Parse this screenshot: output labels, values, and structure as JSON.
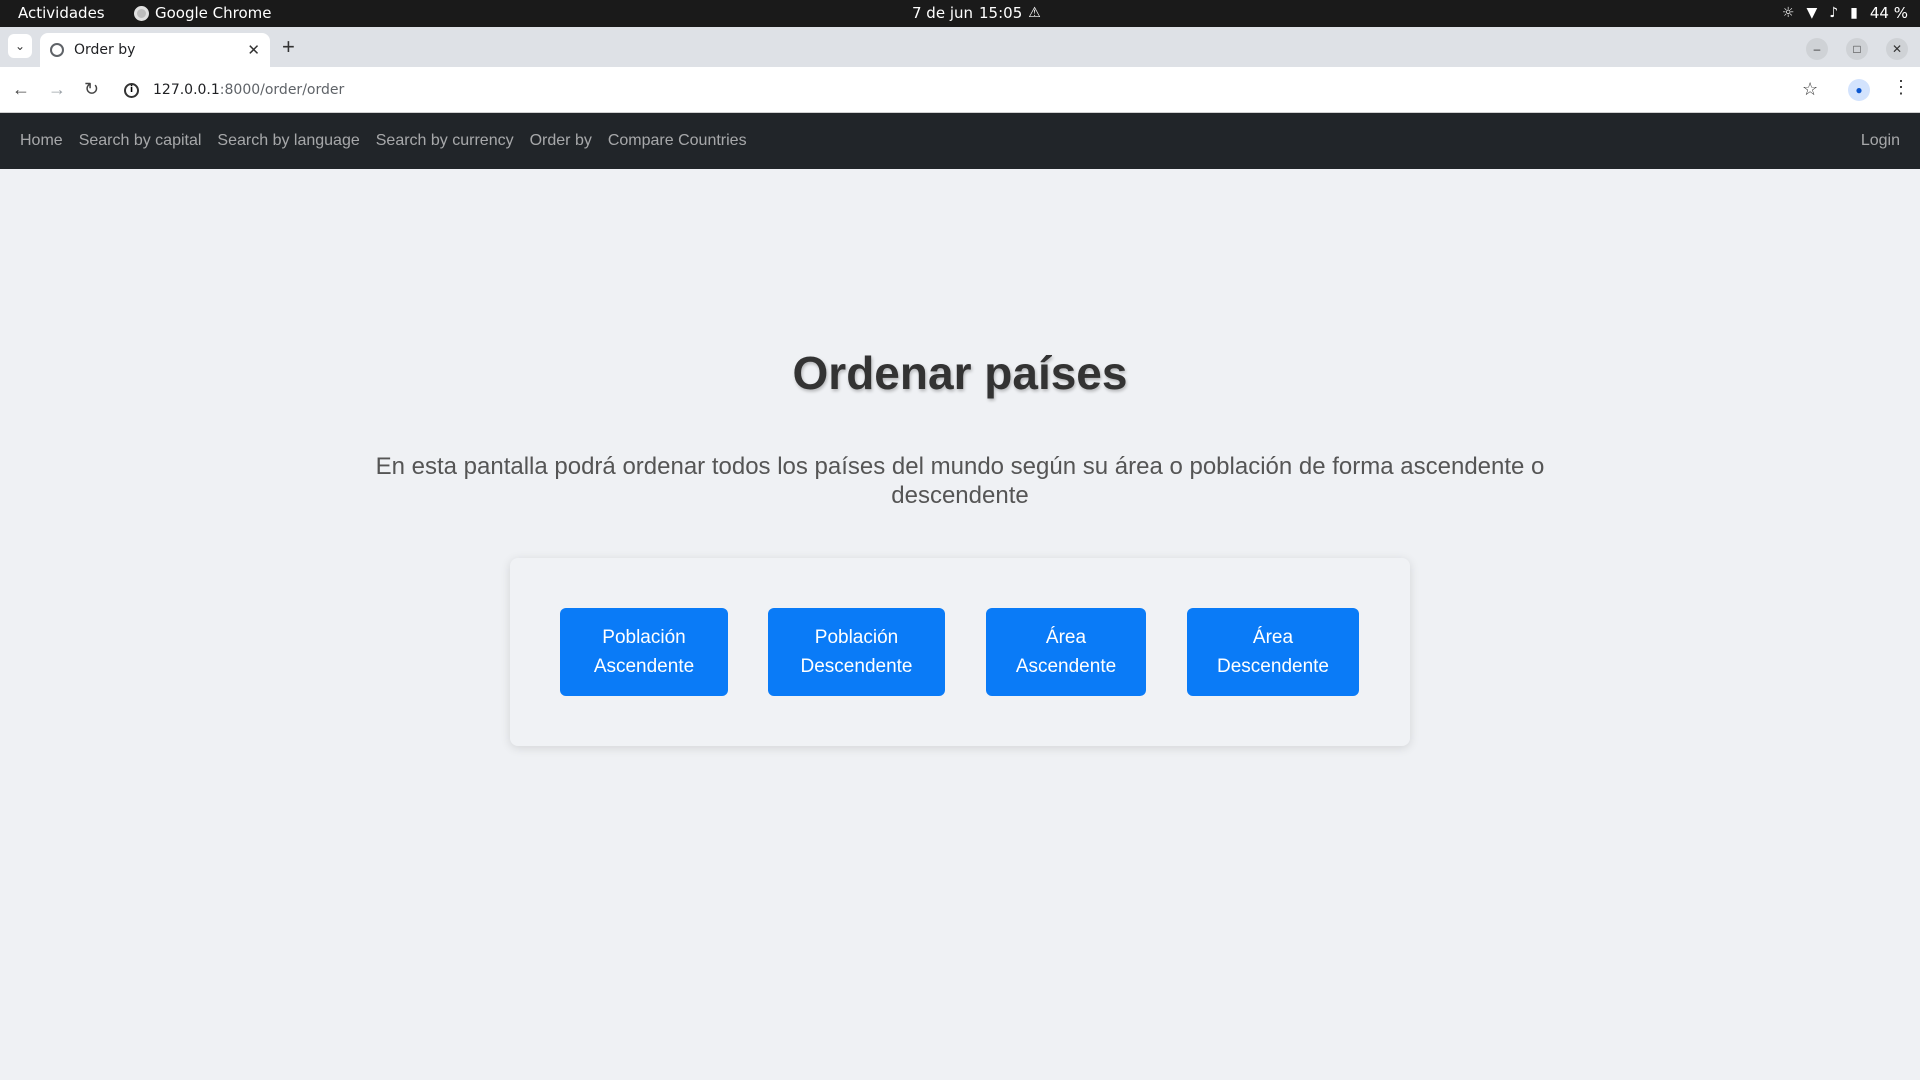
{
  "os": {
    "activities": "Actividades",
    "app_name": "Google Chrome",
    "date": "7 de jun",
    "time": "15:05",
    "battery": "44 %"
  },
  "browser": {
    "tab_title": "Order by",
    "url_host": "127.0.0.1",
    "url_path": ":8000/order/order"
  },
  "navbar": {
    "links": [
      "Home",
      "Search by capital",
      "Search by language",
      "Search by currency",
      "Order by",
      "Compare Countries"
    ],
    "login": "Login"
  },
  "main": {
    "title": "Ordenar países",
    "description": "En esta pantalla podrá ordenar todos los países del mundo según su área o población de forma ascendente o descendente",
    "buttons": [
      {
        "line1": "Población",
        "line2": "Ascendente"
      },
      {
        "line1": "Población",
        "line2": "Descendente"
      },
      {
        "line1": "Área",
        "line2": "Ascendente"
      },
      {
        "line1": "Área",
        "line2": "Descendente"
      }
    ]
  },
  "colors": {
    "primary_button": "#0a7bf7",
    "navbar_bg": "#212529",
    "page_bg": "#eff1f4"
  }
}
